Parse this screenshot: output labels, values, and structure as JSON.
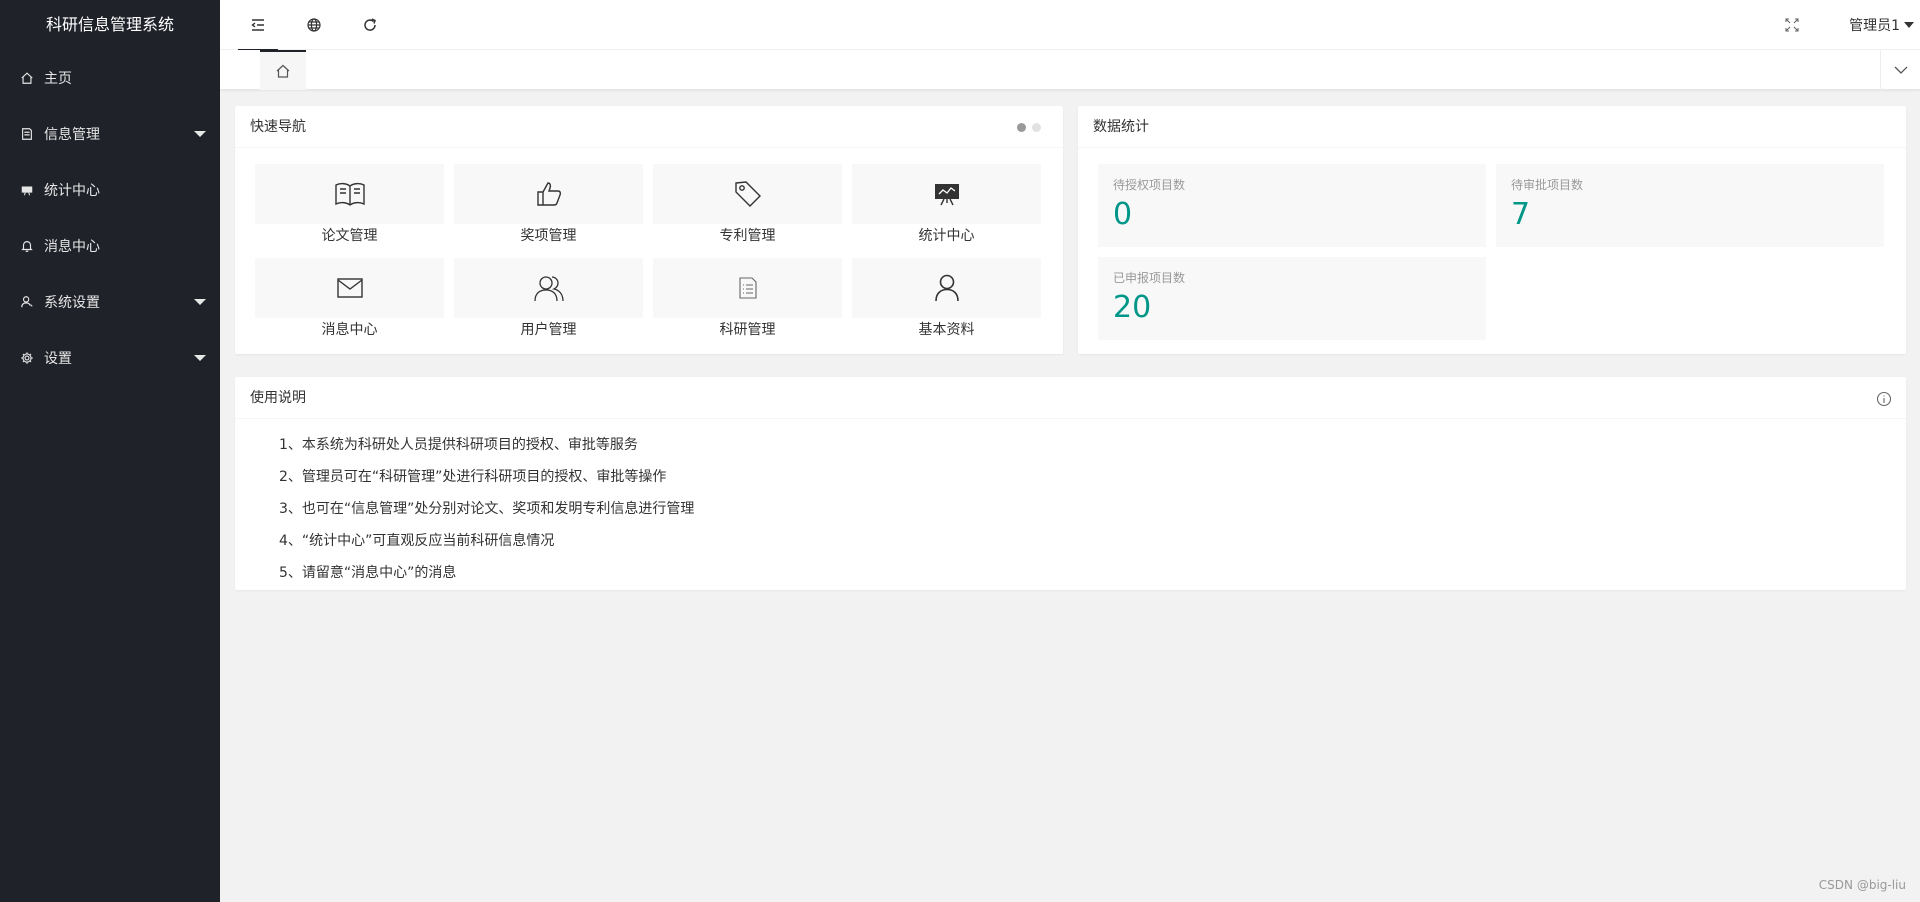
{
  "app": {
    "title": "科研信息管理系统"
  },
  "sidebar": {
    "items": [
      {
        "label": "主页",
        "icon": "home-icon",
        "expandable": false
      },
      {
        "label": "信息管理",
        "icon": "note-icon",
        "expandable": true
      },
      {
        "label": "统计中心",
        "icon": "stats-icon",
        "expandable": false
      },
      {
        "label": "消息中心",
        "icon": "bell-icon",
        "expandable": false
      },
      {
        "label": "系统设置",
        "icon": "user-settings-icon",
        "expandable": true
      },
      {
        "label": "设置",
        "icon": "gear-icon",
        "expandable": true
      }
    ]
  },
  "header": {
    "icons": [
      "menu-fold-icon",
      "globe-icon",
      "refresh-icon",
      "fullscreen-icon"
    ],
    "user": "管理员1"
  },
  "tabs": {
    "home_icon": "home-icon",
    "more_icon": "chevron-down-icon"
  },
  "quick_nav": {
    "title": "快速导航",
    "items": [
      {
        "label": "论文管理",
        "icon": "book-icon"
      },
      {
        "label": "奖项管理",
        "icon": "thumbs-up-icon"
      },
      {
        "label": "专利管理",
        "icon": "tag-icon"
      },
      {
        "label": "统计中心",
        "icon": "presentation-chart-icon"
      },
      {
        "label": "消息中心",
        "icon": "mail-icon"
      },
      {
        "label": "用户管理",
        "icon": "users-icon"
      },
      {
        "label": "科研管理",
        "icon": "list-document-icon"
      },
      {
        "label": "基本资料",
        "icon": "user-icon"
      }
    ]
  },
  "stats": {
    "title": "数据统计",
    "items": [
      {
        "label": "待授权项目数",
        "value": "0"
      },
      {
        "label": "待审批项目数",
        "value": "7"
      },
      {
        "label": "已申报项目数",
        "value": "20"
      }
    ]
  },
  "usage": {
    "title": "使用说明",
    "items": [
      "1、本系统为科研处人员提供科研项目的授权、审批等服务",
      "2、管理员可在“科研管理”处进行科研项目的授权、审批等操作",
      "3、也可在“信息管理”处分别对论文、奖项和发明专利信息进行管理",
      "4、“统计中心”可直观反应当前科研信息情况",
      "5、请留意“消息中心”的消息"
    ]
  },
  "watermark": "CSDN @big-liu",
  "colors": {
    "sidebar": "#20222a",
    "accent": "#009688",
    "background": "#f2f2f2"
  }
}
